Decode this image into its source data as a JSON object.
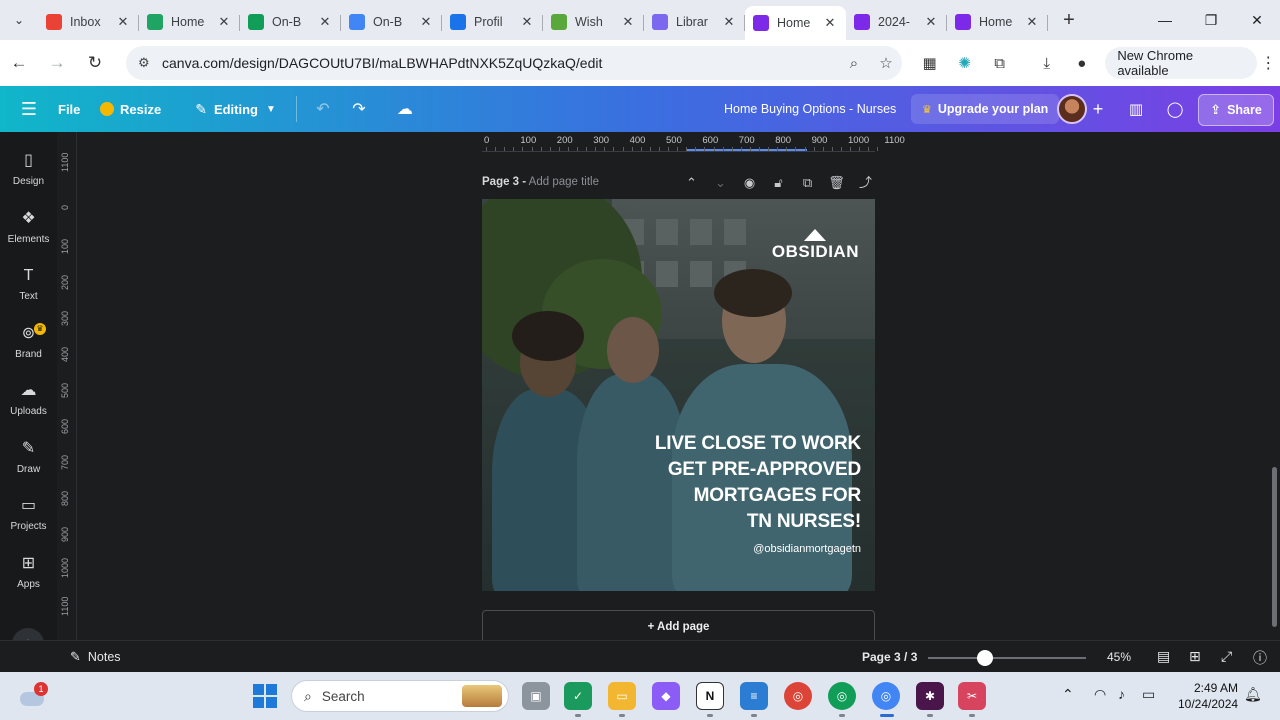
{
  "tabs": [
    {
      "title": "Inbox",
      "favicon": "gmail-icon",
      "color": "#ea4335",
      "active": false
    },
    {
      "title": "Home",
      "favicon": "drive-icon",
      "color": "#1fa463",
      "active": false
    },
    {
      "title": "On-B",
      "favicon": "sheets-icon",
      "color": "#0f9d58",
      "active": false
    },
    {
      "title": "On-B",
      "favicon": "docs-icon",
      "color": "#4285f4",
      "active": false
    },
    {
      "title": "Profil",
      "favicon": "profile-icon",
      "color": "#1a73e8",
      "active": false
    },
    {
      "title": "Wish",
      "favicon": "check-icon",
      "color": "#5aa83b",
      "active": false
    },
    {
      "title": "Librar",
      "favicon": "gear-icon",
      "color": "#7b68ee",
      "active": false
    },
    {
      "title": "Home",
      "favicon": "canva-icon",
      "color": "#7d2ae8",
      "active": true
    },
    {
      "title": "2024-",
      "favicon": "canva-icon",
      "color": "#7d2ae8",
      "active": false
    },
    {
      "title": "Home",
      "favicon": "canva-icon",
      "color": "#7d2ae8",
      "active": false
    }
  ],
  "address": {
    "url": "canva.com/design/DAGCOUtU7BI/maLBWHAPdtNXK5ZqUQzkaQ/edit",
    "new_chrome": "New Chrome available"
  },
  "toolbar": {
    "file": "File",
    "resize": "Resize",
    "editing": "Editing",
    "design_title": "Home Buying Options - Nurses",
    "upgrade": "Upgrade your plan",
    "share": "Share"
  },
  "sidebar": {
    "items": [
      {
        "label": "Design",
        "icon": "design-icon"
      },
      {
        "label": "Elements",
        "icon": "elements-icon"
      },
      {
        "label": "Text",
        "icon": "text-icon"
      },
      {
        "label": "Brand",
        "icon": "brand-icon"
      },
      {
        "label": "Uploads",
        "icon": "uploads-icon"
      },
      {
        "label": "Draw",
        "icon": "draw-icon"
      },
      {
        "label": "Projects",
        "icon": "projects-icon"
      },
      {
        "label": "Apps",
        "icon": "apps-icon"
      }
    ]
  },
  "ruler": {
    "horizontal": [
      "0",
      "100",
      "200",
      "300",
      "400",
      "500",
      "600",
      "700",
      "800",
      "900",
      "1000",
      "1100"
    ],
    "vertical": [
      "1100",
      "0",
      "100",
      "200",
      "300",
      "400",
      "500",
      "600",
      "700",
      "800",
      "900",
      "1000",
      "1100"
    ]
  },
  "page": {
    "label": "Page 3 -",
    "placeholder": "Add page title",
    "logo_text": "OBSIDIAN",
    "headline": [
      "LIVE CLOSE TO WORK",
      "GET PRE-APPROVED",
      "MORTGAGES FOR",
      "TN NURSES!"
    ],
    "handle": "@obsidianmortgagetn",
    "add_page": "+ Add page"
  },
  "footer": {
    "notes": "Notes",
    "page_indicator": "Page 3 / 3",
    "zoom": "45%",
    "zoom_fraction": 0.45
  },
  "taskbar": {
    "search": "Search",
    "weather_badge": "1",
    "time": "2:49 AM",
    "date": "10/24/2024"
  }
}
